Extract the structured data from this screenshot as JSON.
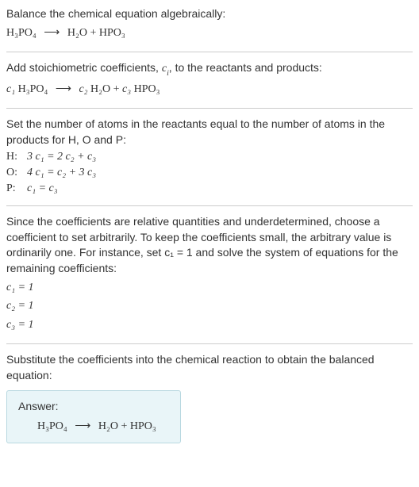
{
  "sections": {
    "s1": {
      "line1": "Balance the chemical equation algebraically:",
      "reaction_lhs": "H₃PO₄",
      "reaction_arrow": "⟶",
      "reaction_rhs": "H₂O + HPO₃"
    },
    "s2": {
      "line1_before": "Add stoichiometric coefficients, ",
      "line1_ci": "c",
      "line1_i": "i",
      "line1_after": ", to the reactants and products:",
      "c1": "c₁",
      "c2": "c₂",
      "c3": "c₃",
      "lhs": " H₃PO₄",
      "arrow": "⟶",
      "mid": " H₂O + ",
      "rhs": " HPO₃"
    },
    "s3": {
      "line1": "Set the number of atoms in the reactants equal to the number of atoms in the products for H, O and P:",
      "rows": [
        {
          "label": "H:",
          "eq": "3 c₁ = 2 c₂ + c₃"
        },
        {
          "label": "O:",
          "eq": "4 c₁ = c₂ + 3 c₃"
        },
        {
          "label": "P:",
          "eq": "c₁ = c₃"
        }
      ]
    },
    "s4": {
      "line1": "Since the coefficients are relative quantities and underdetermined, choose a coefficient to set arbitrarily. To keep the coefficients small, the arbitrary value is ordinarily one. For instance, set c₁ = 1 and solve the system of equations for the remaining coefficients:",
      "eqs": [
        "c₁ = 1",
        "c₂ = 1",
        "c₃ = 1"
      ]
    },
    "s5": {
      "line1": "Substitute the coefficients into the chemical reaction to obtain the balanced equation:",
      "answer_label": "Answer:",
      "reaction_lhs": "H₃PO₄",
      "reaction_arrow": "⟶",
      "reaction_rhs": "H₂O + HPO₃"
    }
  }
}
